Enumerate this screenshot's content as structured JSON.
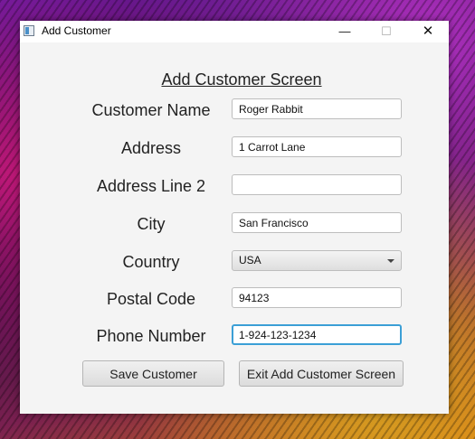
{
  "window": {
    "title": "Add Customer"
  },
  "form": {
    "heading": "Add Customer Screen",
    "fields": [
      {
        "label": "Customer Name",
        "value": "Roger Rabbit"
      },
      {
        "label": "Address",
        "value": "1 Carrot Lane"
      },
      {
        "label": "Address Line 2",
        "value": ""
      },
      {
        "label": "City",
        "value": "San Francisco"
      },
      {
        "label": "Country",
        "value": "USA"
      },
      {
        "label": "Postal Code",
        "value": "94123"
      },
      {
        "label": "Phone Number",
        "value": "1-924-123-1234"
      }
    ]
  },
  "buttons": {
    "save": "Save Customer",
    "exit": "Exit Add Customer Screen"
  },
  "icons": {
    "minimize": "minimize-icon",
    "maximize": "maximize-icon",
    "close": "close-icon",
    "dropdown": "chevron-down-icon"
  }
}
